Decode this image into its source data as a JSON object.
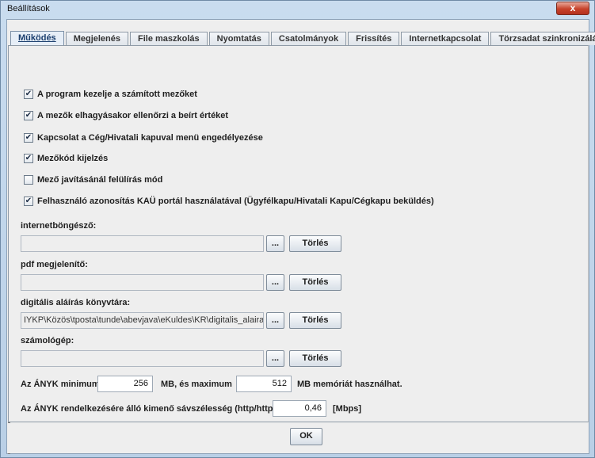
{
  "window": {
    "title": "Beállítások",
    "close_glyph": "x"
  },
  "tabs": [
    {
      "label": "Működés",
      "active": true
    },
    {
      "label": "Megjelenés"
    },
    {
      "label": "File maszkolás"
    },
    {
      "label": "Nyomtatás"
    },
    {
      "label": "Csatolmányok"
    },
    {
      "label": "Frissítés"
    },
    {
      "label": "Internetkapcsolat"
    },
    {
      "label": "Törzsadat szinkronizálás"
    }
  ],
  "checkboxes": [
    {
      "label": "A program kezelje a számított mezőket",
      "checked": true
    },
    {
      "label": "A mezők elhagyásakor ellenőrzi a beírt értéket",
      "checked": true
    },
    {
      "label": "Kapcsolat a Cég/Hivatali kapuval menü engedélyezése",
      "checked": true
    },
    {
      "label": "Mezőkód kijelzés",
      "checked": true
    },
    {
      "label": "Mező javításánál felülírás mód",
      "checked": false
    },
    {
      "label": "Felhasználó azonosítás KAÜ portál használatával (Ügyfélkapu/Hivatali Kapu/Cégkapu beküldés)",
      "checked": true
    }
  ],
  "check_glyph": "✔",
  "paths": [
    {
      "label": "internetböngésző:",
      "value": "",
      "browse": "...",
      "clear": "Törlés"
    },
    {
      "label": "pdf megjelenítő:",
      "value": "",
      "browse": "...",
      "clear": "Törlés"
    },
    {
      "label": "digitális aláírás könyvtára:",
      "value": "IYKP\\Közös\\tposta\\tunde\\abevjava\\eKuldes\\KR\\digitalis_alairas",
      "browse": "...",
      "clear": "Törlés"
    },
    {
      "label": "számológép:",
      "value": "",
      "browse": "...",
      "clear": "Törlés"
    }
  ],
  "memory": {
    "prefix": "Az ÁNYK minimum",
    "min": "256",
    "middle": "MB, és maximum",
    "max": "512",
    "suffix": "MB memóriát használhat."
  },
  "bandwidth": {
    "label": "Az ÁNYK rendelkezésére álló kimenő sávszélesség (http/https)",
    "value": "0,46",
    "unit": "[Mbps]"
  },
  "ok_label": "OK"
}
